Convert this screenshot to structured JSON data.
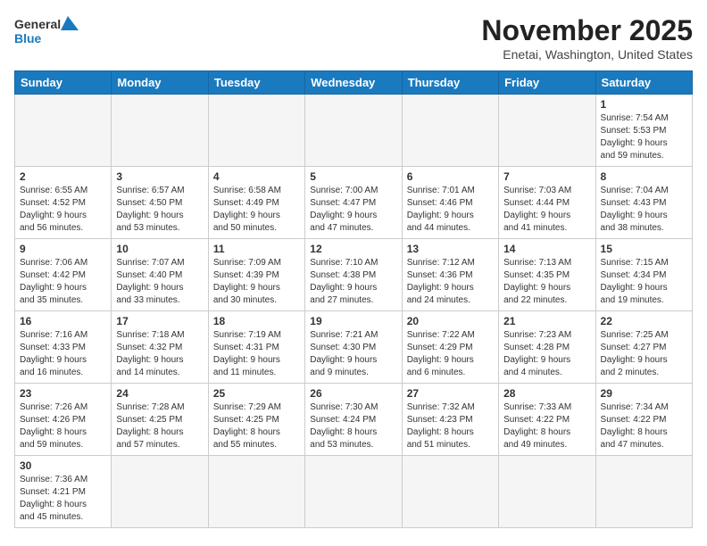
{
  "header": {
    "logo_general": "General",
    "logo_blue": "Blue",
    "month": "November 2025",
    "location": "Enetai, Washington, United States"
  },
  "weekdays": [
    "Sunday",
    "Monday",
    "Tuesday",
    "Wednesday",
    "Thursday",
    "Friday",
    "Saturday"
  ],
  "weeks": [
    [
      {
        "day": "",
        "info": ""
      },
      {
        "day": "",
        "info": ""
      },
      {
        "day": "",
        "info": ""
      },
      {
        "day": "",
        "info": ""
      },
      {
        "day": "",
        "info": ""
      },
      {
        "day": "",
        "info": ""
      },
      {
        "day": "1",
        "info": "Sunrise: 7:54 AM\nSunset: 5:53 PM\nDaylight: 9 hours\nand 59 minutes."
      }
    ],
    [
      {
        "day": "2",
        "info": "Sunrise: 6:55 AM\nSunset: 4:52 PM\nDaylight: 9 hours\nand 56 minutes."
      },
      {
        "day": "3",
        "info": "Sunrise: 6:57 AM\nSunset: 4:50 PM\nDaylight: 9 hours\nand 53 minutes."
      },
      {
        "day": "4",
        "info": "Sunrise: 6:58 AM\nSunset: 4:49 PM\nDaylight: 9 hours\nand 50 minutes."
      },
      {
        "day": "5",
        "info": "Sunrise: 7:00 AM\nSunset: 4:47 PM\nDaylight: 9 hours\nand 47 minutes."
      },
      {
        "day": "6",
        "info": "Sunrise: 7:01 AM\nSunset: 4:46 PM\nDaylight: 9 hours\nand 44 minutes."
      },
      {
        "day": "7",
        "info": "Sunrise: 7:03 AM\nSunset: 4:44 PM\nDaylight: 9 hours\nand 41 minutes."
      },
      {
        "day": "8",
        "info": "Sunrise: 7:04 AM\nSunset: 4:43 PM\nDaylight: 9 hours\nand 38 minutes."
      }
    ],
    [
      {
        "day": "9",
        "info": "Sunrise: 7:06 AM\nSunset: 4:42 PM\nDaylight: 9 hours\nand 35 minutes."
      },
      {
        "day": "10",
        "info": "Sunrise: 7:07 AM\nSunset: 4:40 PM\nDaylight: 9 hours\nand 33 minutes."
      },
      {
        "day": "11",
        "info": "Sunrise: 7:09 AM\nSunset: 4:39 PM\nDaylight: 9 hours\nand 30 minutes."
      },
      {
        "day": "12",
        "info": "Sunrise: 7:10 AM\nSunset: 4:38 PM\nDaylight: 9 hours\nand 27 minutes."
      },
      {
        "day": "13",
        "info": "Sunrise: 7:12 AM\nSunset: 4:36 PM\nDaylight: 9 hours\nand 24 minutes."
      },
      {
        "day": "14",
        "info": "Sunrise: 7:13 AM\nSunset: 4:35 PM\nDaylight: 9 hours\nand 22 minutes."
      },
      {
        "day": "15",
        "info": "Sunrise: 7:15 AM\nSunset: 4:34 PM\nDaylight: 9 hours\nand 19 minutes."
      }
    ],
    [
      {
        "day": "16",
        "info": "Sunrise: 7:16 AM\nSunset: 4:33 PM\nDaylight: 9 hours\nand 16 minutes."
      },
      {
        "day": "17",
        "info": "Sunrise: 7:18 AM\nSunset: 4:32 PM\nDaylight: 9 hours\nand 14 minutes."
      },
      {
        "day": "18",
        "info": "Sunrise: 7:19 AM\nSunset: 4:31 PM\nDaylight: 9 hours\nand 11 minutes."
      },
      {
        "day": "19",
        "info": "Sunrise: 7:21 AM\nSunset: 4:30 PM\nDaylight: 9 hours\nand 9 minutes."
      },
      {
        "day": "20",
        "info": "Sunrise: 7:22 AM\nSunset: 4:29 PM\nDaylight: 9 hours\nand 6 minutes."
      },
      {
        "day": "21",
        "info": "Sunrise: 7:23 AM\nSunset: 4:28 PM\nDaylight: 9 hours\nand 4 minutes."
      },
      {
        "day": "22",
        "info": "Sunrise: 7:25 AM\nSunset: 4:27 PM\nDaylight: 9 hours\nand 2 minutes."
      }
    ],
    [
      {
        "day": "23",
        "info": "Sunrise: 7:26 AM\nSunset: 4:26 PM\nDaylight: 8 hours\nand 59 minutes."
      },
      {
        "day": "24",
        "info": "Sunrise: 7:28 AM\nSunset: 4:25 PM\nDaylight: 8 hours\nand 57 minutes."
      },
      {
        "day": "25",
        "info": "Sunrise: 7:29 AM\nSunset: 4:25 PM\nDaylight: 8 hours\nand 55 minutes."
      },
      {
        "day": "26",
        "info": "Sunrise: 7:30 AM\nSunset: 4:24 PM\nDaylight: 8 hours\nand 53 minutes."
      },
      {
        "day": "27",
        "info": "Sunrise: 7:32 AM\nSunset: 4:23 PM\nDaylight: 8 hours\nand 51 minutes."
      },
      {
        "day": "28",
        "info": "Sunrise: 7:33 AM\nSunset: 4:22 PM\nDaylight: 8 hours\nand 49 minutes."
      },
      {
        "day": "29",
        "info": "Sunrise: 7:34 AM\nSunset: 4:22 PM\nDaylight: 8 hours\nand 47 minutes."
      }
    ],
    [
      {
        "day": "30",
        "info": "Sunrise: 7:36 AM\nSunset: 4:21 PM\nDaylight: 8 hours\nand 45 minutes."
      },
      {
        "day": "",
        "info": ""
      },
      {
        "day": "",
        "info": ""
      },
      {
        "day": "",
        "info": ""
      },
      {
        "day": "",
        "info": ""
      },
      {
        "day": "",
        "info": ""
      },
      {
        "day": "",
        "info": ""
      }
    ]
  ]
}
